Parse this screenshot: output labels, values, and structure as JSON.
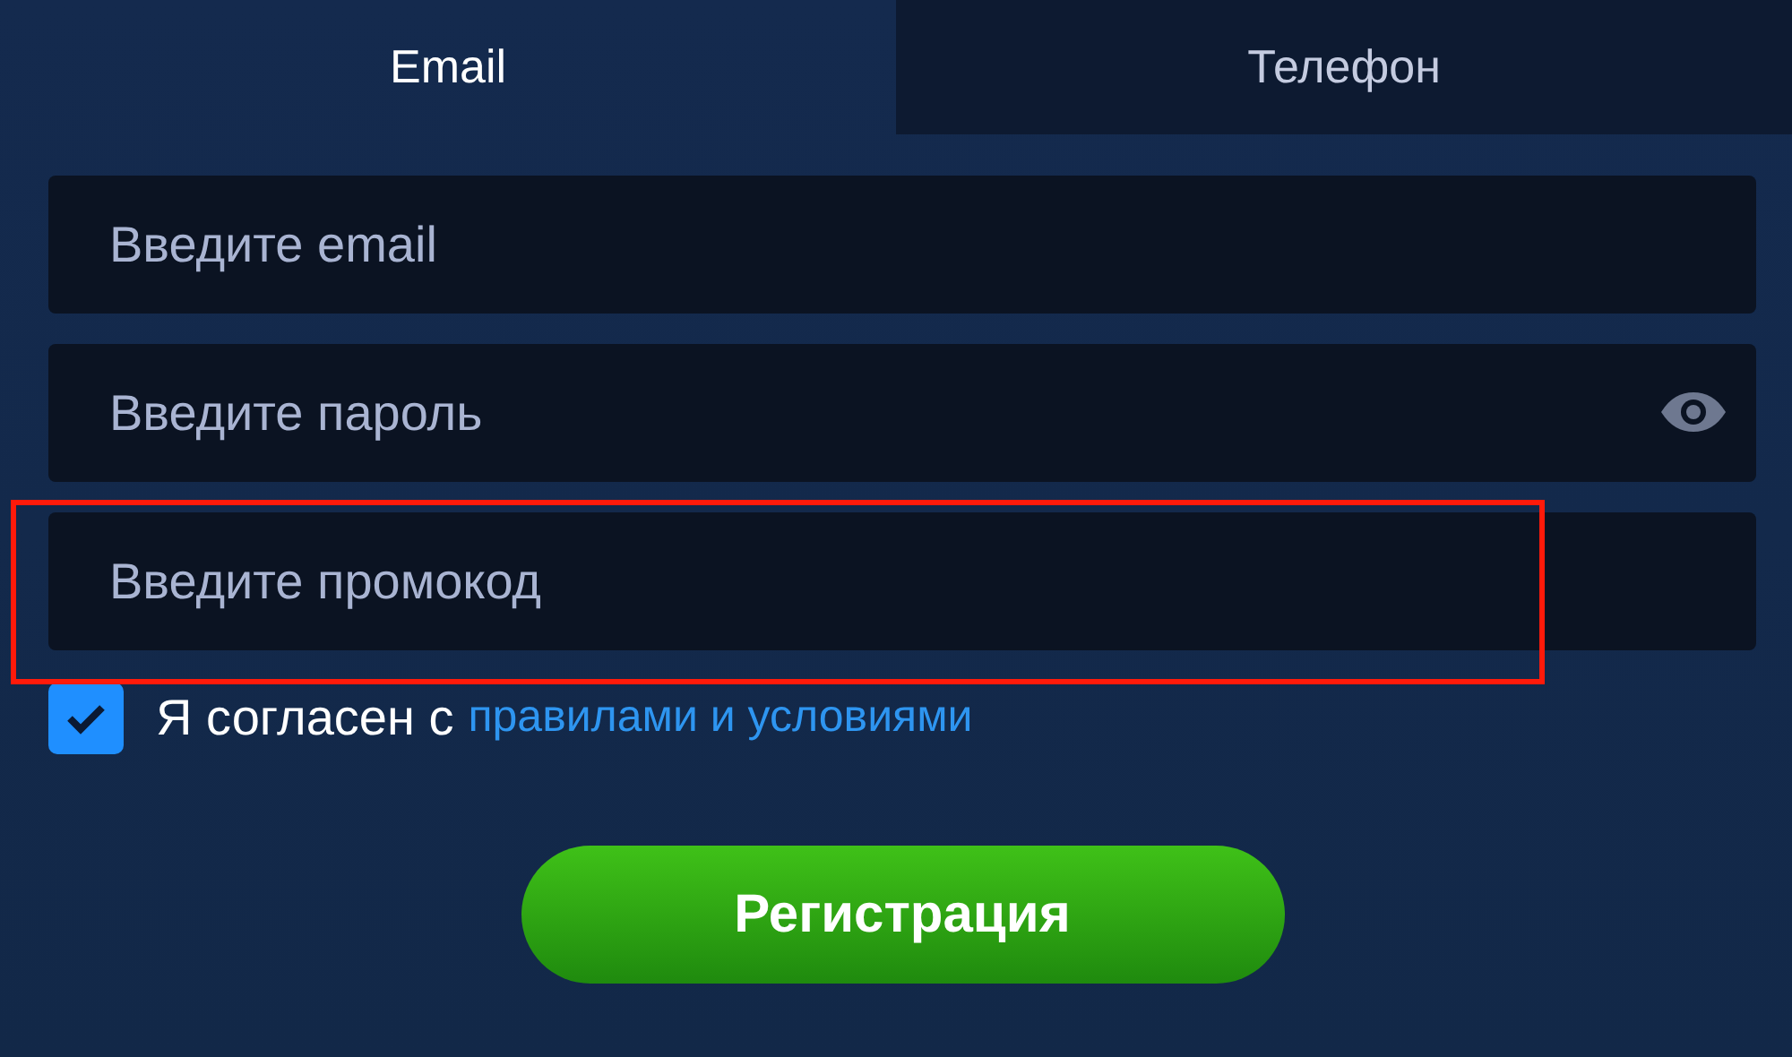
{
  "tabs": [
    {
      "label": "Email",
      "selected": true
    },
    {
      "label": "Телефон",
      "selected": false
    }
  ],
  "fields": [
    {
      "placeholder": "Введите email",
      "kind": "text",
      "highlighted": false
    },
    {
      "placeholder": "Введите пароль",
      "kind": "password",
      "highlighted": false
    },
    {
      "placeholder": "Введите промокод",
      "kind": "text",
      "highlighted": true
    }
  ],
  "agreement": {
    "checked": true,
    "text": "Я согласен с",
    "link": "правилами и условиями"
  },
  "submit": {
    "label": "Регистрация"
  }
}
